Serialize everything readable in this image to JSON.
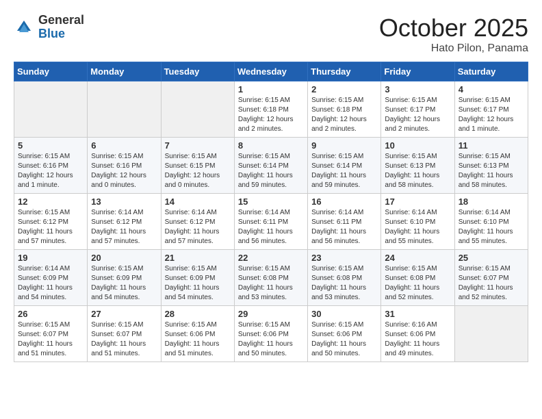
{
  "header": {
    "logo_general": "General",
    "logo_blue": "Blue",
    "month": "October 2025",
    "location": "Hato Pilon, Panama"
  },
  "days_of_week": [
    "Sunday",
    "Monday",
    "Tuesday",
    "Wednesday",
    "Thursday",
    "Friday",
    "Saturday"
  ],
  "weeks": [
    [
      {
        "day": "",
        "info": ""
      },
      {
        "day": "",
        "info": ""
      },
      {
        "day": "",
        "info": ""
      },
      {
        "day": "1",
        "info": "Sunrise: 6:15 AM\nSunset: 6:18 PM\nDaylight: 12 hours\nand 2 minutes."
      },
      {
        "day": "2",
        "info": "Sunrise: 6:15 AM\nSunset: 6:18 PM\nDaylight: 12 hours\nand 2 minutes."
      },
      {
        "day": "3",
        "info": "Sunrise: 6:15 AM\nSunset: 6:17 PM\nDaylight: 12 hours\nand 2 minutes."
      },
      {
        "day": "4",
        "info": "Sunrise: 6:15 AM\nSunset: 6:17 PM\nDaylight: 12 hours\nand 1 minute."
      }
    ],
    [
      {
        "day": "5",
        "info": "Sunrise: 6:15 AM\nSunset: 6:16 PM\nDaylight: 12 hours\nand 1 minute."
      },
      {
        "day": "6",
        "info": "Sunrise: 6:15 AM\nSunset: 6:16 PM\nDaylight: 12 hours\nand 0 minutes."
      },
      {
        "day": "7",
        "info": "Sunrise: 6:15 AM\nSunset: 6:15 PM\nDaylight: 12 hours\nand 0 minutes."
      },
      {
        "day": "8",
        "info": "Sunrise: 6:15 AM\nSunset: 6:14 PM\nDaylight: 11 hours\nand 59 minutes."
      },
      {
        "day": "9",
        "info": "Sunrise: 6:15 AM\nSunset: 6:14 PM\nDaylight: 11 hours\nand 59 minutes."
      },
      {
        "day": "10",
        "info": "Sunrise: 6:15 AM\nSunset: 6:13 PM\nDaylight: 11 hours\nand 58 minutes."
      },
      {
        "day": "11",
        "info": "Sunrise: 6:15 AM\nSunset: 6:13 PM\nDaylight: 11 hours\nand 58 minutes."
      }
    ],
    [
      {
        "day": "12",
        "info": "Sunrise: 6:15 AM\nSunset: 6:12 PM\nDaylight: 11 hours\nand 57 minutes."
      },
      {
        "day": "13",
        "info": "Sunrise: 6:14 AM\nSunset: 6:12 PM\nDaylight: 11 hours\nand 57 minutes."
      },
      {
        "day": "14",
        "info": "Sunrise: 6:14 AM\nSunset: 6:12 PM\nDaylight: 11 hours\nand 57 minutes."
      },
      {
        "day": "15",
        "info": "Sunrise: 6:14 AM\nSunset: 6:11 PM\nDaylight: 11 hours\nand 56 minutes."
      },
      {
        "day": "16",
        "info": "Sunrise: 6:14 AM\nSunset: 6:11 PM\nDaylight: 11 hours\nand 56 minutes."
      },
      {
        "day": "17",
        "info": "Sunrise: 6:14 AM\nSunset: 6:10 PM\nDaylight: 11 hours\nand 55 minutes."
      },
      {
        "day": "18",
        "info": "Sunrise: 6:14 AM\nSunset: 6:10 PM\nDaylight: 11 hours\nand 55 minutes."
      }
    ],
    [
      {
        "day": "19",
        "info": "Sunrise: 6:14 AM\nSunset: 6:09 PM\nDaylight: 11 hours\nand 54 minutes."
      },
      {
        "day": "20",
        "info": "Sunrise: 6:15 AM\nSunset: 6:09 PM\nDaylight: 11 hours\nand 54 minutes."
      },
      {
        "day": "21",
        "info": "Sunrise: 6:15 AM\nSunset: 6:09 PM\nDaylight: 11 hours\nand 54 minutes."
      },
      {
        "day": "22",
        "info": "Sunrise: 6:15 AM\nSunset: 6:08 PM\nDaylight: 11 hours\nand 53 minutes."
      },
      {
        "day": "23",
        "info": "Sunrise: 6:15 AM\nSunset: 6:08 PM\nDaylight: 11 hours\nand 53 minutes."
      },
      {
        "day": "24",
        "info": "Sunrise: 6:15 AM\nSunset: 6:08 PM\nDaylight: 11 hours\nand 52 minutes."
      },
      {
        "day": "25",
        "info": "Sunrise: 6:15 AM\nSunset: 6:07 PM\nDaylight: 11 hours\nand 52 minutes."
      }
    ],
    [
      {
        "day": "26",
        "info": "Sunrise: 6:15 AM\nSunset: 6:07 PM\nDaylight: 11 hours\nand 51 minutes."
      },
      {
        "day": "27",
        "info": "Sunrise: 6:15 AM\nSunset: 6:07 PM\nDaylight: 11 hours\nand 51 minutes."
      },
      {
        "day": "28",
        "info": "Sunrise: 6:15 AM\nSunset: 6:06 PM\nDaylight: 11 hours\nand 51 minutes."
      },
      {
        "day": "29",
        "info": "Sunrise: 6:15 AM\nSunset: 6:06 PM\nDaylight: 11 hours\nand 50 minutes."
      },
      {
        "day": "30",
        "info": "Sunrise: 6:15 AM\nSunset: 6:06 PM\nDaylight: 11 hours\nand 50 minutes."
      },
      {
        "day": "31",
        "info": "Sunrise: 6:16 AM\nSunset: 6:06 PM\nDaylight: 11 hours\nand 49 minutes."
      },
      {
        "day": "",
        "info": ""
      }
    ]
  ]
}
